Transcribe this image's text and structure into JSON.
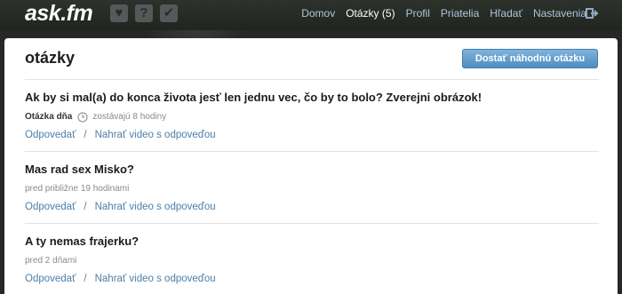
{
  "brand": {
    "logo": "ask.fm"
  },
  "top_icons": [
    {
      "name": "likes-icon",
      "glyph": "♥"
    },
    {
      "name": "question-icon",
      "glyph": "?"
    },
    {
      "name": "check-icon",
      "glyph": "✔"
    }
  ],
  "nav": {
    "home": "Domov",
    "questions": "Otázky (5)",
    "profile": "Profil",
    "friends": "Priatelia",
    "search": "Hľadať",
    "settings": "Nastavenia"
  },
  "page": {
    "title": "otázky",
    "random_button": "Dostať náhodnú otázku"
  },
  "questions": [
    {
      "text": "Ak by si mal(a) do konca života jesť len jednu vec, čo by to bolo? Zverejni obrázok!",
      "tag": "Otázka dňa",
      "time": "zostávajú 8 hodiny",
      "answer": "Odpovedať",
      "video": "Nahrať video s odpoveďou"
    },
    {
      "text": "Mas rad sex Misko?",
      "time": "pred približne 19 hodinami",
      "answer": "Odpovedať",
      "video": "Nahrať video s odpoveďou"
    },
    {
      "text": "A ty nemas frajerku?",
      "time": "pred 2 dňami",
      "answer": "Odpovedať",
      "video": "Nahrať video s odpoveďou"
    }
  ],
  "colors": {
    "accent_link": "#4d7fa8",
    "nav_link": "#aac6dc",
    "button": "#5b96c6"
  }
}
